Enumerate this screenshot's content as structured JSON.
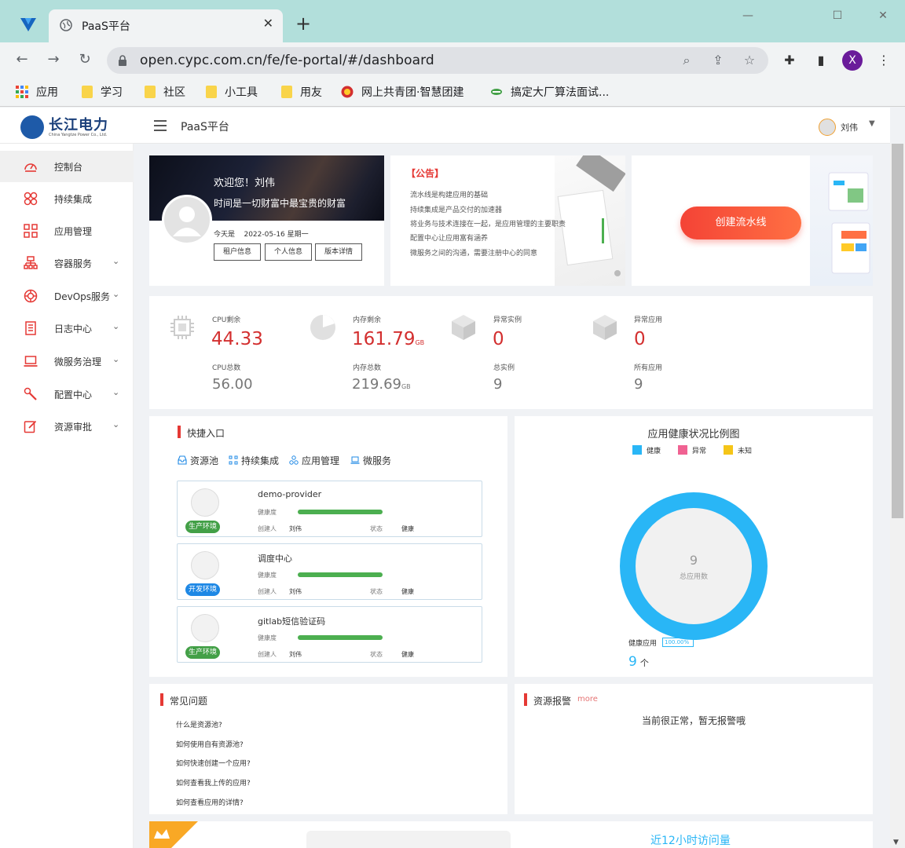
{
  "browser": {
    "tab_title": "PaaS平台",
    "tab_close": "✕",
    "new_tab": "+",
    "url": "open.cypc.com.cn/fe/fe-portal/#/dashboard",
    "profile_initial": "X",
    "window_minimize": "—",
    "window_maximize": "☐",
    "window_close": "✕",
    "bookmarks": [
      "应用",
      "学习",
      "社区",
      "小工具",
      "用友",
      "网上共青团·智慧团建",
      "搞定大厂算法面试..."
    ]
  },
  "header": {
    "brand_name": "长江电力",
    "brand_sub": "China Yangtze Power Co., Ltd.",
    "title": "PaaS平台",
    "user_name": "刘伟",
    "user_caret": "▼"
  },
  "sidebar": {
    "items": [
      {
        "label": "控制台",
        "icon": "dashboard-icon",
        "active": true,
        "expandable": false
      },
      {
        "label": "持续集成",
        "icon": "integration-icon",
        "active": false,
        "expandable": false
      },
      {
        "label": "应用管理",
        "icon": "grid-icon",
        "active": false,
        "expandable": false
      },
      {
        "label": "容器服务",
        "icon": "container-icon",
        "active": false,
        "expandable": true
      },
      {
        "label": "DevOps服务",
        "icon": "lifebuoy-icon",
        "active": false,
        "expandable": true
      },
      {
        "label": "日志中心",
        "icon": "document-icon",
        "active": false,
        "expandable": true
      },
      {
        "label": "微服务治理",
        "icon": "laptop-icon",
        "active": false,
        "expandable": true
      },
      {
        "label": "配置中心",
        "icon": "wrench-icon",
        "active": false,
        "expandable": true
      },
      {
        "label": "资源审批",
        "icon": "edit-icon",
        "active": false,
        "expandable": true
      }
    ],
    "caret": "⌄"
  },
  "welcome": {
    "greeting": "欢迎您！刘伟",
    "motto": "时间是一切财富中最宝贵的财富",
    "date_label": "今天是",
    "date_value": "2022-05-16 星期一",
    "buttons": [
      "租户信息",
      "个人信息",
      "版本详情"
    ]
  },
  "notice": {
    "title": "【公告】",
    "lines": [
      "流水线是构建应用的基础",
      "持续集成是产品交付的加速器",
      "将业务与技术连接在一起，是应用管理的主要职责",
      "配置中心让应用富有涵养",
      "微服务之间的沟通，需要注册中心的同意"
    ]
  },
  "create_pipeline": {
    "label": "创建流水线"
  },
  "stats": [
    {
      "label": "CPU剩余",
      "value": "44.33",
      "unit": "",
      "total_label": "CPU总数",
      "total": "56.00",
      "total_unit": ""
    },
    {
      "label": "内存剩余",
      "value": "161.79",
      "unit": "GB",
      "total_label": "内存总数",
      "total": "219.69",
      "total_unit": "GB"
    },
    {
      "label": "异常实例",
      "value": "0",
      "unit": "",
      "total_label": "总实例",
      "total": "9",
      "total_unit": ""
    },
    {
      "label": "异常应用",
      "value": "0",
      "unit": "",
      "total_label": "所有应用",
      "total": "9",
      "total_unit": ""
    }
  ],
  "quick": {
    "title": "快捷入口",
    "links": [
      "资源池",
      "持续集成",
      "应用管理",
      "微服务"
    ],
    "health_label": "健康度",
    "creator_label": "创建人",
    "status_label": "状态",
    "apps": [
      {
        "name": "demo-provider",
        "env": "生产环境",
        "env_color": "#43a047",
        "creator": "刘伟",
        "status": "健康",
        "health": 1.0
      },
      {
        "name": "调度中心",
        "env": "开发环境",
        "env_color": "#1e88e5",
        "creator": "刘伟",
        "status": "健康",
        "health": 1.0
      },
      {
        "name": "gitlab短信验证码",
        "env": "生产环境",
        "env_color": "#43a047",
        "creator": "刘伟",
        "status": "健康",
        "health": 1.0
      }
    ]
  },
  "health_chart": {
    "title": "应用健康状况比例图",
    "legend": [
      {
        "label": "健康",
        "color": "#29b6f6"
      },
      {
        "label": "异常",
        "color": "#f06292"
      },
      {
        "label": "未知",
        "color": "#f5c518"
      }
    ],
    "center_value": "9",
    "center_label": "总应用数",
    "callout_label": "健康应用",
    "callout_pct": "100.00%",
    "count": "9",
    "count_unit": "个"
  },
  "chart_data": {
    "type": "pie",
    "title": "应用健康状况比例图",
    "categories": [
      "健康",
      "异常",
      "未知"
    ],
    "values": [
      9,
      0,
      0
    ],
    "colors": [
      "#29b6f6",
      "#f06292",
      "#f5c518"
    ],
    "legend": "top"
  },
  "faq": {
    "title": "常见问题",
    "items": [
      "什么是资源池?",
      "如何使用自有资源池?",
      "如何快速创建一个应用?",
      "如何查看我上传的应用?",
      "如何查看应用的详情?"
    ]
  },
  "alarm": {
    "title": "资源报警",
    "more": "more",
    "message": "当前很正常，暂无报警哦"
  },
  "visits": {
    "title": "近12小时访问量"
  }
}
